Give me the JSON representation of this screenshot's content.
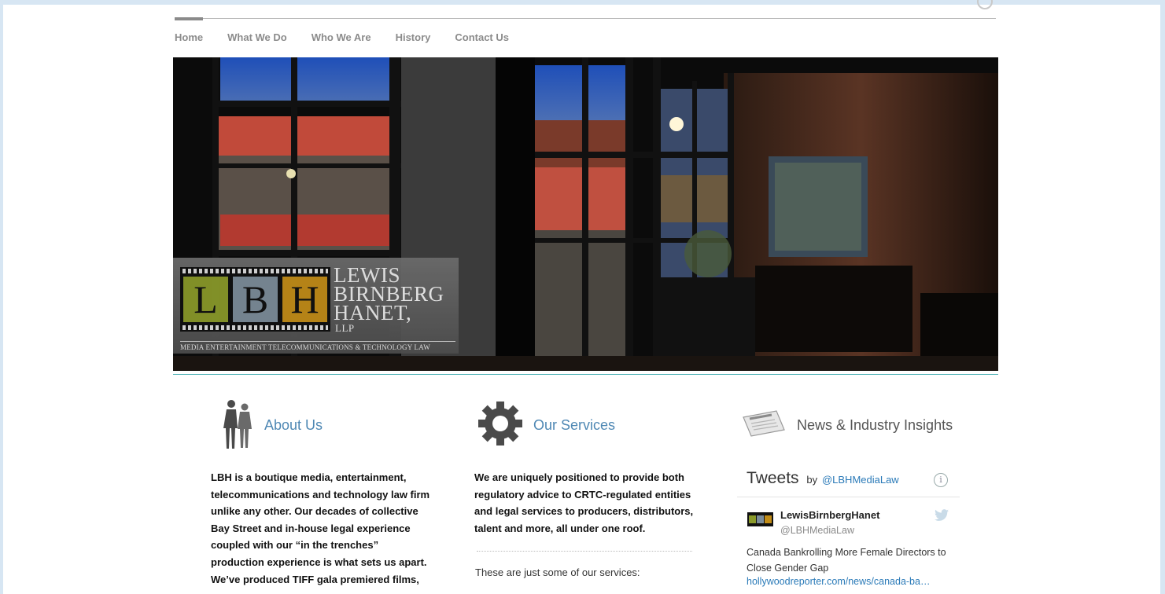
{
  "nav": {
    "items": [
      "Home",
      "What We Do",
      "Who We Are",
      "History",
      "Contact Us"
    ]
  },
  "logo": {
    "letters": [
      "L",
      "B",
      "H"
    ],
    "line1": "LEWIS",
    "line2": "BIRNBERG",
    "line3": "HANET,",
    "llp": "LLP",
    "tagline": "MEDIA ENTERTAINMENT TELECOMMUNICATIONS & TECHNOLOGY LAW"
  },
  "about": {
    "icon": "people-silhouette-icon",
    "title": "About Us",
    "lines": [
      "LBH is a boutique media, entertainment,",
      "telecommunications and technology law firm",
      "unlike any other. Our decades of collective",
      "Bay Street and in-house legal experience",
      "coupled with our “in the trenches”",
      "production experience is what sets us apart.",
      "We’ve produced TIFF gala premiered films,"
    ]
  },
  "services": {
    "icon": "gear-icon",
    "title": "Our Services",
    "lines": [
      "We are uniquely positioned to provide both",
      "regulatory advice to CRTC-regulated entities",
      "and legal services to producers, distributors,",
      "talent and more, all under one roof."
    ],
    "subheading": "These are just some of our services:"
  },
  "news": {
    "icon": "newspaper-icon",
    "title": "News & Industry Insights",
    "widget": {
      "title": "Tweets",
      "by": "by",
      "handle_link": "@LBHMediaLaw",
      "info_icon": "info-icon",
      "tweet": {
        "name": "LewisBirnbergHanet",
        "username": "@LBHMediaLaw",
        "text": "Canada Bankrolling More Female Directors to Close Gender Gap",
        "link": "hollywoodreporter.com/news/canada-ba…"
      }
    }
  },
  "colors": {
    "accent_blue": "#4f88b4",
    "nav_grey": "#8b8b8b",
    "divider_teal": "#4fb3b6",
    "twitter_link": "#2a7ab8"
  }
}
